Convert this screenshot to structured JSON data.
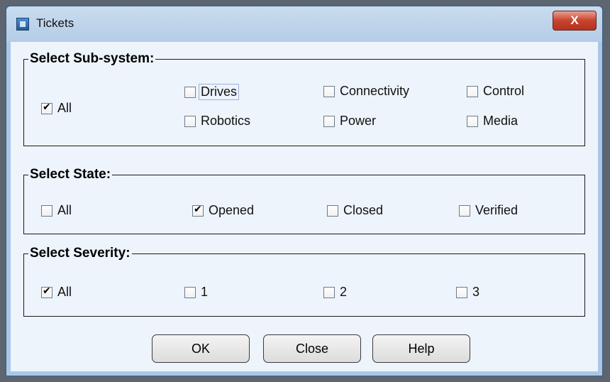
{
  "window": {
    "title": "Tickets",
    "close_glyph": "X"
  },
  "subsystem": {
    "legend": "Select Sub-system:",
    "all": {
      "label": "All",
      "checked": true
    },
    "options": [
      {
        "label": "Drives",
        "checked": false
      },
      {
        "label": "Connectivity",
        "checked": false
      },
      {
        "label": "Control",
        "checked": false
      },
      {
        "label": "Robotics",
        "checked": false
      },
      {
        "label": "Power",
        "checked": false
      },
      {
        "label": "Media",
        "checked": false
      }
    ]
  },
  "state": {
    "legend": "Select State:",
    "options": [
      {
        "label": "All",
        "checked": false
      },
      {
        "label": "Opened",
        "checked": true
      },
      {
        "label": "Closed",
        "checked": false
      },
      {
        "label": "Verified",
        "checked": false
      }
    ]
  },
  "severity": {
    "legend": "Select Severity:",
    "options": [
      {
        "label": "All",
        "checked": true
      },
      {
        "label": "1",
        "checked": false
      },
      {
        "label": "2",
        "checked": false
      },
      {
        "label": "3",
        "checked": false
      }
    ]
  },
  "buttons": {
    "ok": "OK",
    "close": "Close",
    "help": "Help"
  },
  "colors": {
    "titlebar": "#b4cde8",
    "close_button": "#c8432d",
    "client_bg": "#edf4fb"
  }
}
